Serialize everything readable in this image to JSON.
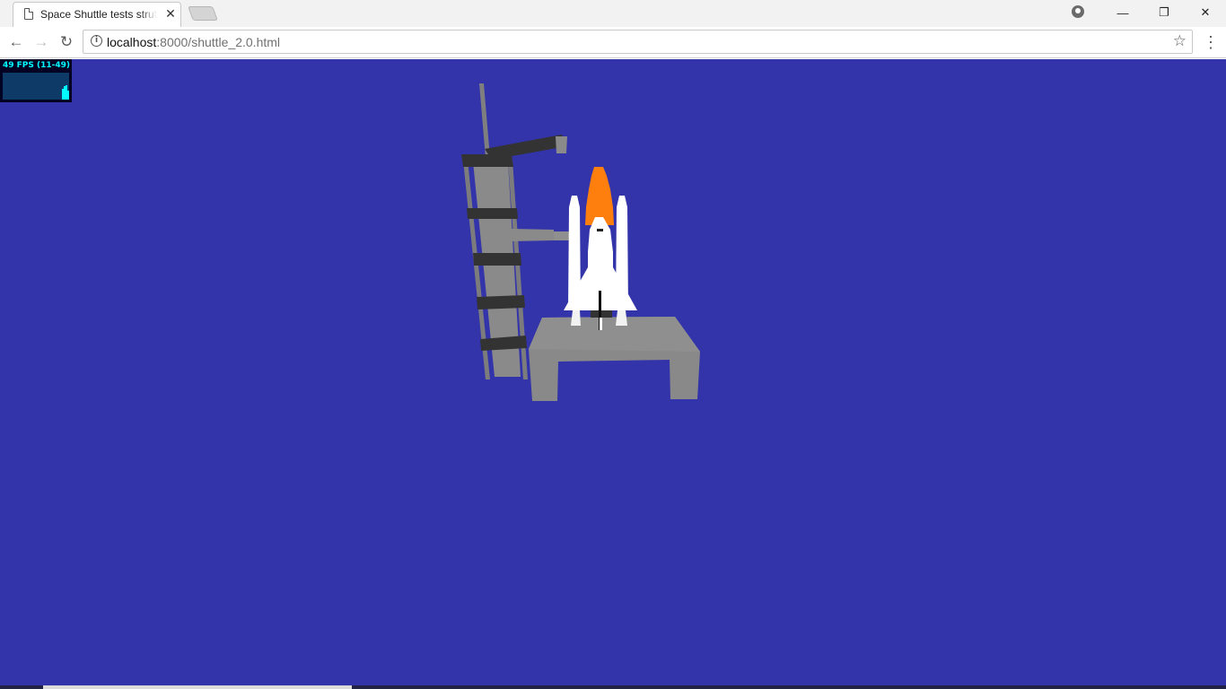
{
  "window": {
    "tab_title": "Space Shuttle tests strut",
    "tab_close": "✕"
  },
  "toolbar": {
    "back": "←",
    "forward": "→",
    "reload": "↻",
    "url_host": "localhost",
    "url_rest": ":8000/shuttle_2.0.html",
    "bookmark": "☆",
    "menu": "⋮"
  },
  "controls": {
    "minimize": "—",
    "maximize": "❐",
    "close": "✕"
  },
  "stats": {
    "fps_label": "49 FPS (11-49)"
  },
  "colors": {
    "background": "#3434aa",
    "tower": "#8a8a8a",
    "tower_bands": "#333333",
    "shuttle": "#ffffff",
    "external_tank": "#ff7f0e",
    "platform": "#888888"
  },
  "icons": [
    "page-icon",
    "close-icon",
    "new-tab-icon",
    "profile-icon",
    "minimize-icon",
    "maximize-icon",
    "close-window-icon",
    "back-icon",
    "forward-icon",
    "reload-icon",
    "info-icon",
    "star-icon",
    "menu-icon"
  ]
}
